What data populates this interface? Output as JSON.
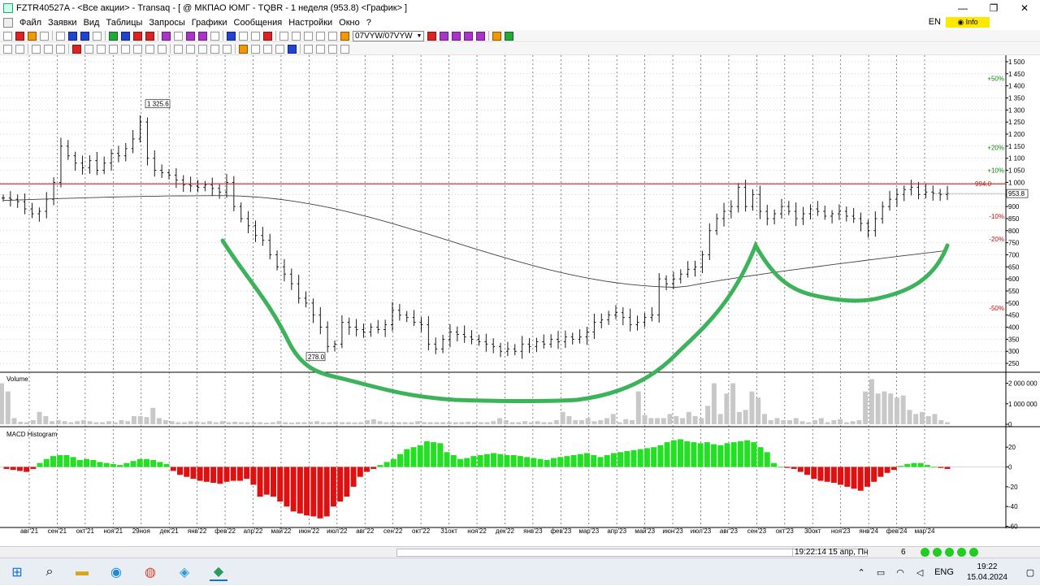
{
  "window": {
    "title": "FZTR40527A - <Все акции> - Transaq - [ @ МКПАО ЮМГ - TQBR - 1 неделя (953.8) <График> ]",
    "controls": [
      "—",
      "❐",
      "✕"
    ]
  },
  "menu": {
    "items": [
      "Файл",
      "Заявки",
      "Вид",
      "Таблицы",
      "Запросы",
      "Графики",
      "Сообщения",
      "Настройки",
      "Окно",
      "?"
    ],
    "lang": "EN",
    "info": "◉ Info"
  },
  "toolbar": {
    "period": "07VYW/07VYW"
  },
  "chart_data": [
    {
      "type": "candlestick",
      "panel": "price",
      "x_labels": [
        "авг'21",
        "сен'21",
        "окт'21",
        "ноя'21",
        "29ноя",
        "дек'21",
        "янв'22",
        "фев'22",
        "апр'22",
        "май'22",
        "июн'22",
        "июл'22",
        "авг'22",
        "сен'22",
        "окт'22",
        "31окт",
        "ноя'22",
        "дек'22",
        "янв'23",
        "фев'23",
        "мар'23",
        "апр'23",
        "май'23",
        "июн'23",
        "июл'23",
        "авг'23",
        "сен'23",
        "окт'23",
        "30окт",
        "ноя'23",
        "янв'24",
        "фев'24",
        "мар'24"
      ],
      "y_ticks": [
        "1 500",
        "1 450",
        "1 400",
        "1 350",
        "1 300",
        "1 250",
        "1 200",
        "1 150",
        "1 100",
        "1 050",
        "1 000",
        "950",
        "900",
        "850",
        "800",
        "750",
        "700",
        "650",
        "600",
        "550",
        "500",
        "450",
        "400",
        "350",
        "300",
        "250"
      ],
      "ylim": [
        220,
        1520
      ],
      "percent_labels": [
        {
          "text": "+50%",
          "value": 1430,
          "color": "#0a8a0a"
        },
        {
          "text": "+20%",
          "value": 1145,
          "color": "#0a8a0a"
        },
        {
          "text": "+10%",
          "value": 1050,
          "color": "#0a8a0a"
        },
        {
          "text": "-10%",
          "value": 860,
          "color": "#c01010"
        },
        {
          "text": "-20%",
          "value": 765,
          "color": "#c01010"
        },
        {
          "text": "-50%",
          "value": 480,
          "color": "#c01010"
        }
      ],
      "annotations": [
        {
          "text": "1 325.6",
          "value": 1325.6
        },
        {
          "text": "278.0",
          "value": 278.0
        }
      ],
      "resistance": {
        "value": 994,
        "label": "994.0",
        "color": "#c02020"
      },
      "last_price": {
        "value": 953.8,
        "label": "953.8"
      },
      "weekly_close": [
        935,
        930,
        920,
        890,
        870,
        880,
        930,
        1000,
        1150,
        1110,
        1080,
        1060,
        1090,
        1050,
        1080,
        1120,
        1110,
        1140,
        1180,
        1250,
        1100,
        1050,
        1040,
        1030,
        1010,
        990,
        985,
        980,
        990,
        975,
        960,
        1000,
        900,
        850,
        820,
        780,
        760,
        700,
        650,
        620,
        580,
        520,
        500,
        450,
        400,
        320,
        330,
        420,
        400,
        390,
        380,
        400,
        390,
        410,
        470,
        450,
        440,
        420,
        410,
        330,
        310,
        350,
        380,
        370,
        360,
        350,
        340,
        330,
        320,
        300,
        310,
        300,
        330,
        320,
        340,
        330,
        350,
        340,
        360,
        350,
        360,
        380,
        420,
        430,
        450,
        460,
        440,
        410,
        420,
        440,
        450,
        600,
        580,
        600,
        620,
        640,
        650,
        700,
        800,
        850,
        880,
        900,
        980,
        900,
        950,
        880,
        850,
        870,
        900,
        880,
        850,
        870,
        890,
        880,
        860,
        870,
        880,
        860,
        850,
        830,
        800,
        850,
        900,
        930,
        950,
        970,
        980,
        950,
        960,
        955,
        950,
        953.8
      ],
      "moving_average": {
        "color": "#404040",
        "start_value": 925,
        "peak_value": 945,
        "bottom_value": 565,
        "end_value": 718
      }
    },
    {
      "type": "bar",
      "panel": "volume",
      "title": "Volume",
      "y_ticks": [
        "2 000 000",
        "1 000 000",
        "0"
      ],
      "ylim": [
        0,
        2300000
      ],
      "values": [
        2000000,
        1600000,
        300000,
        120000,
        100000,
        200000,
        600000,
        400000,
        150000,
        200000,
        150000,
        100000,
        150000,
        200000,
        150000,
        100000,
        100000,
        150000,
        100000,
        200000,
        150000,
        400000,
        400000,
        350000,
        800000,
        300000,
        200000,
        150000,
        100000,
        100000,
        150000,
        120000,
        100000,
        150000,
        100000,
        150000,
        100000,
        120000,
        100000,
        100000,
        100000,
        100000,
        80000,
        100000,
        150000,
        100000,
        80000,
        100000,
        100000,
        120000,
        150000,
        100000,
        100000,
        120000,
        100000,
        100000,
        90000,
        100000,
        200000,
        250000,
        150000,
        100000,
        100000,
        100000,
        100000,
        100000,
        150000,
        100000,
        100000,
        100000,
        100000,
        100000,
        100000,
        100000,
        120000,
        100000,
        100000,
        100000,
        150000,
        300000,
        200000,
        100000,
        100000,
        150000,
        100000,
        150000,
        100000,
        100000,
        200000,
        600000,
        400000,
        200000,
        200000,
        300000,
        150000,
        200000,
        300000,
        500000,
        100000,
        250000,
        200000,
        1600000,
        450000,
        300000,
        300000,
        300000,
        500000,
        400000,
        300000,
        600000,
        400000,
        300000,
        900000,
        2000000,
        500000,
        1500000,
        2000000,
        600000,
        700000,
        1600000,
        1300000,
        500000,
        200000,
        300000,
        200000,
        200000,
        300000,
        150000,
        100000,
        200000,
        300000,
        100000,
        200000,
        250000,
        100000,
        150000,
        200000,
        1600000,
        2200000,
        1500000,
        1600000,
        1500000,
        1300000,
        1400000,
        700000,
        500000,
        600000,
        400000,
        500000,
        200000,
        100000
      ]
    },
    {
      "type": "bar",
      "panel": "macd",
      "title": "MACD Histogram",
      "y_ticks": [
        "20",
        "0",
        "-20",
        "-40",
        "-60"
      ],
      "ylim": [
        -62,
        30
      ],
      "positive_color": "#22e022",
      "negative_color": "#e01010",
      "values": [
        -2,
        -3,
        -4,
        -5,
        -2,
        4,
        8,
        11,
        12,
        12,
        10,
        7,
        8,
        7,
        5,
        4,
        3,
        2,
        4,
        6,
        8,
        8,
        7,
        5,
        3,
        -4,
        -8,
        -10,
        -12,
        -14,
        -15,
        -16,
        -17,
        -15,
        -14,
        -14,
        -12,
        -18,
        -30,
        -28,
        -30,
        -35,
        -40,
        -45,
        -47,
        -49,
        -50,
        -52,
        -50,
        -40,
        -35,
        -30,
        -20,
        -10,
        -5,
        -2,
        2,
        5,
        8,
        13,
        18,
        20,
        22,
        26,
        25,
        24,
        15,
        12,
        8,
        9,
        11,
        12,
        13,
        14,
        13,
        12,
        12,
        11,
        10,
        9,
        8,
        7,
        9,
        10,
        11,
        12,
        13,
        14,
        12,
        10,
        12,
        14,
        15,
        16,
        17,
        18,
        19,
        20,
        22,
        25,
        27,
        28,
        26,
        25,
        24,
        25,
        23,
        22,
        24,
        25,
        26,
        27,
        25,
        20,
        15,
        4,
        0,
        -1,
        -2,
        -5,
        -8,
        -12,
        -14,
        -15,
        -16,
        -18,
        -20,
        -22,
        -24,
        -20,
        -15,
        -10,
        -6,
        -3,
        1,
        3,
        4,
        4,
        2,
        0,
        -1,
        -2
      ]
    }
  ],
  "status": {
    "time": "19:22:14  15 апр, Пн",
    "count": "6"
  },
  "taskbar": {
    "lang": "ENG",
    "time": "19:22",
    "date": "15.04.2024"
  }
}
